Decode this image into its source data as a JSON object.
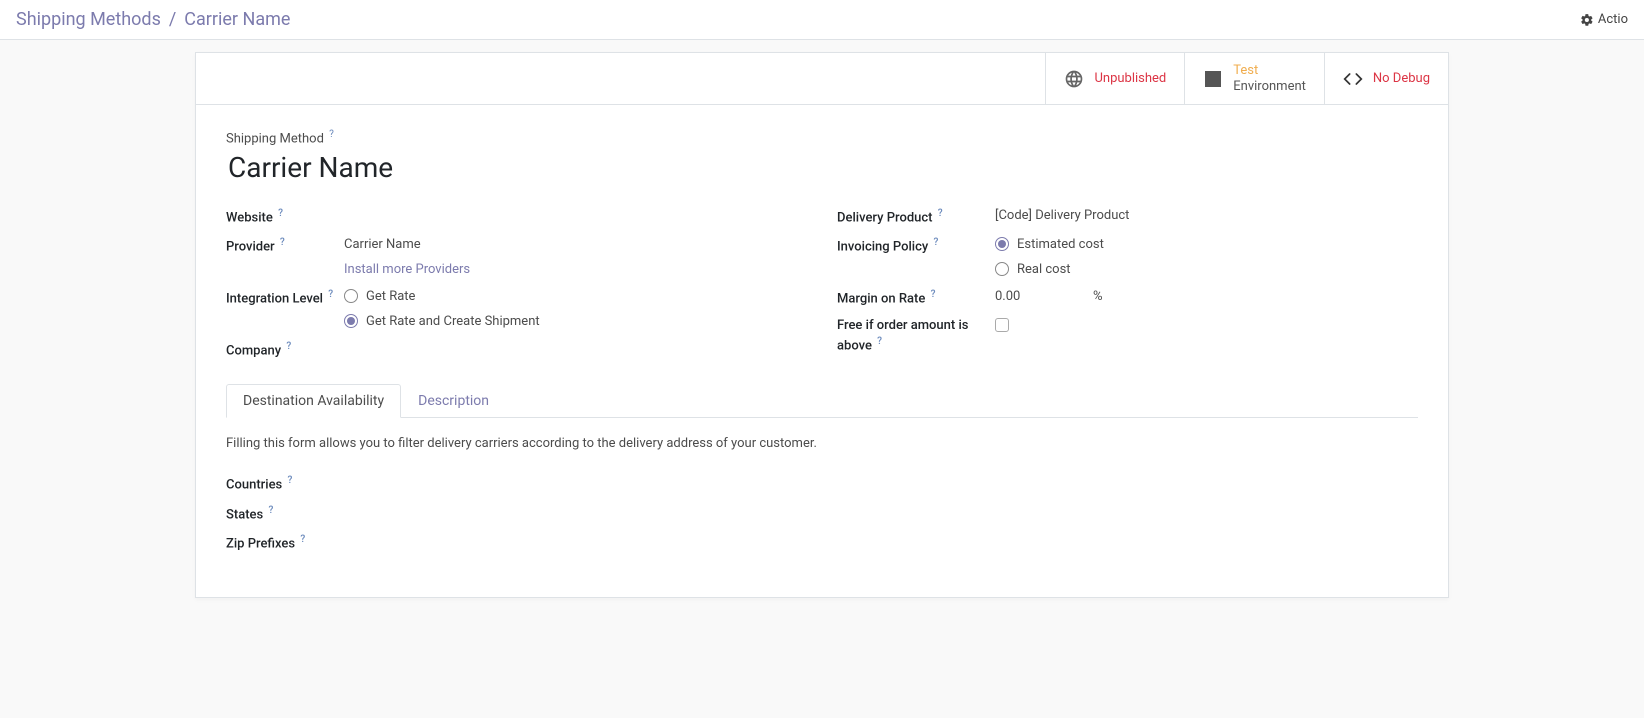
{
  "breadcrumb": {
    "parent": "Shipping Methods",
    "separator": "/",
    "current": "Carrier Name"
  },
  "actions_menu": {
    "label": "Actio"
  },
  "status": {
    "publish": {
      "label": "Unpublished"
    },
    "environment": {
      "highlight": "Test",
      "sub": "Environment"
    },
    "debug": {
      "label": "No Debug"
    }
  },
  "form": {
    "title_label": "Shipping Method",
    "title_value": "Carrier Name",
    "left": {
      "website": {
        "label": "Website",
        "value": ""
      },
      "provider": {
        "label": "Provider",
        "value": "Carrier Name",
        "install_link": "Install more Providers"
      },
      "integration": {
        "label": "Integration Level",
        "options": [
          {
            "label": "Get Rate",
            "checked": false
          },
          {
            "label": "Get Rate and Create Shipment",
            "checked": true
          }
        ]
      },
      "company": {
        "label": "Company",
        "value": ""
      }
    },
    "right": {
      "delivery_product": {
        "label": "Delivery Product",
        "value": "[Code] Delivery Product"
      },
      "invoicing": {
        "label": "Invoicing Policy",
        "options": [
          {
            "label": "Estimated cost",
            "checked": true
          },
          {
            "label": "Real cost",
            "checked": false
          }
        ]
      },
      "margin": {
        "label": "Margin on Rate",
        "value": "0.00",
        "unit": "%"
      },
      "free_if": {
        "label": "Free if order amount is above",
        "checked": false
      }
    }
  },
  "tabs": {
    "items": [
      {
        "label": "Destination Availability",
        "active": true
      },
      {
        "label": "Description",
        "active": false
      }
    ],
    "destination": {
      "hint": "Filling this form allows you to filter delivery carriers according to the delivery address of your customer.",
      "countries": {
        "label": "Countries"
      },
      "states": {
        "label": "States"
      },
      "zip": {
        "label": "Zip Prefixes"
      }
    }
  }
}
